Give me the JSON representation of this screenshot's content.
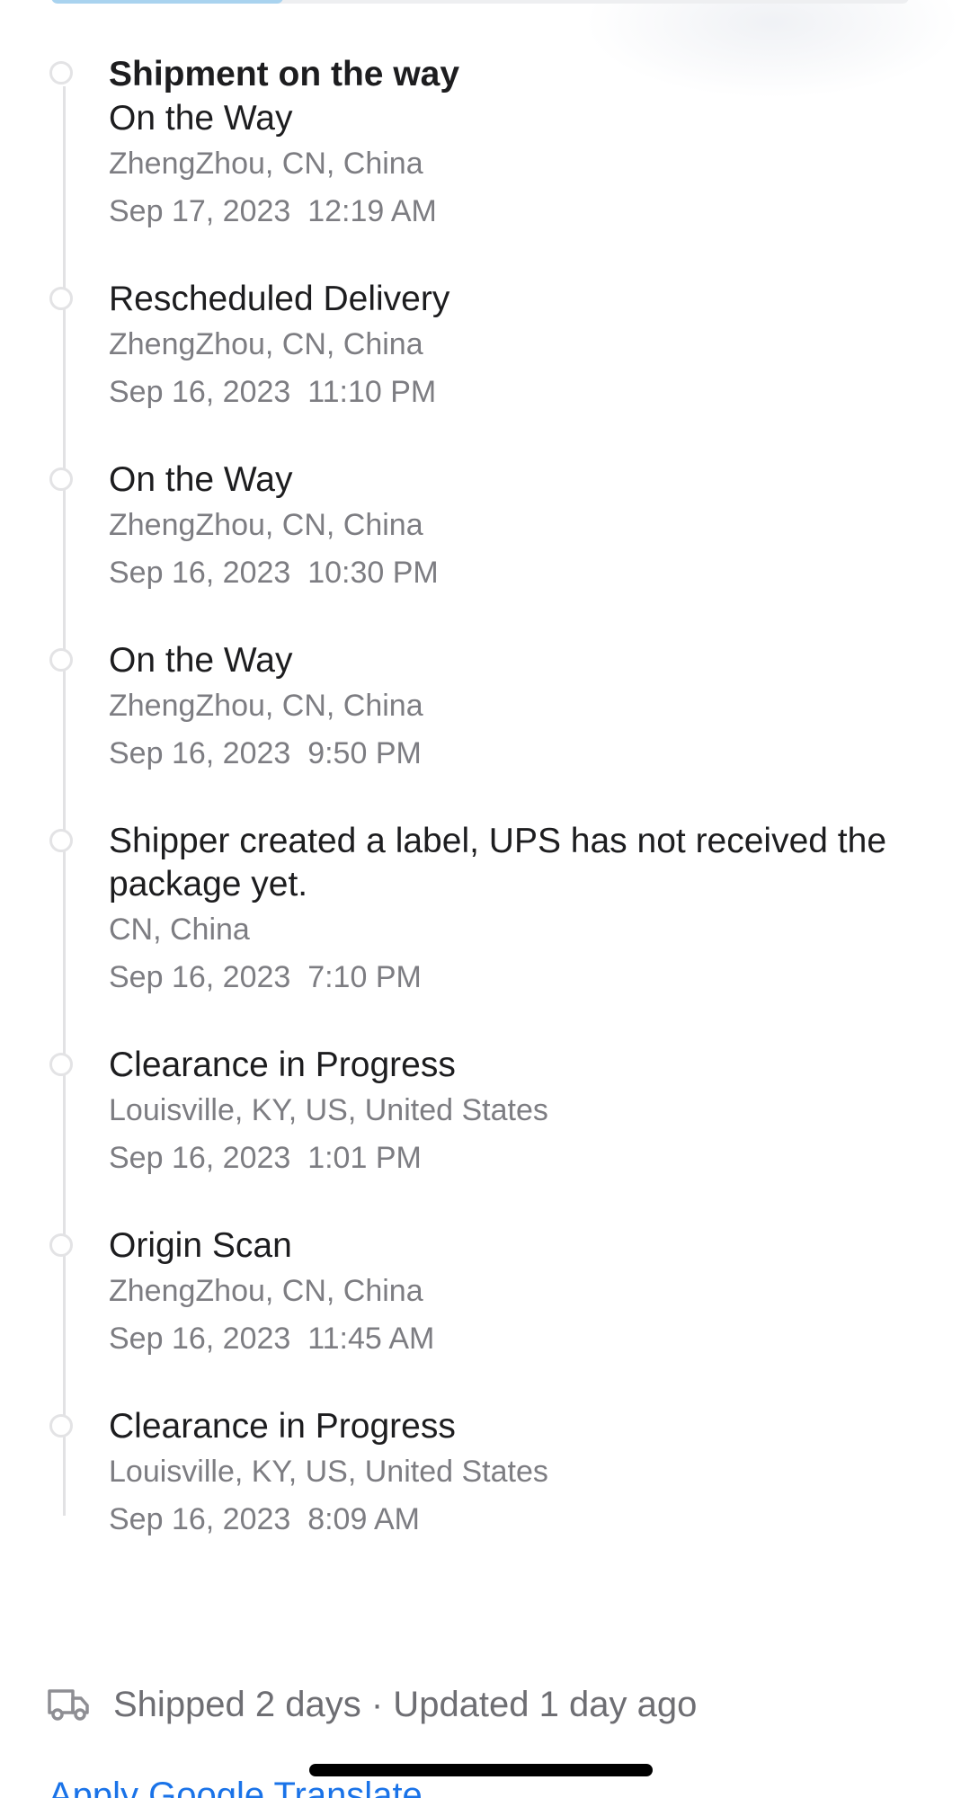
{
  "progress": {
    "fill_fraction": 0.27,
    "track_color": "#eeeff1",
    "fill_color": "#a9d3ef"
  },
  "events": [
    {
      "title": "Shipment on the way",
      "status": "On the Way",
      "location": "ZhengZhou, CN, China",
      "date": "Sep 17, 2023",
      "time": "12:19 AM"
    },
    {
      "status": "Rescheduled Delivery",
      "location": "ZhengZhou, CN, China",
      "date": "Sep 16, 2023",
      "time": "11:10 PM"
    },
    {
      "status": "On the Way",
      "location": "ZhengZhou, CN, China",
      "date": "Sep 16, 2023",
      "time": "10:30 PM"
    },
    {
      "status": "On the Way",
      "location": "ZhengZhou, CN, China",
      "date": "Sep 16, 2023",
      "time": "9:50 PM"
    },
    {
      "status": "Shipper created a label, UPS has not received the package yet.",
      "location": "CN, China",
      "date": "Sep 16, 2023",
      "time": "7:10 PM"
    },
    {
      "status": "Clearance in Progress",
      "location": "Louisville, KY, US, United States",
      "date": "Sep 16, 2023",
      "time": "1:01 PM"
    },
    {
      "status": "Origin Scan",
      "location": "ZhengZhou, CN, China",
      "date": "Sep 16, 2023",
      "time": "11:45 AM"
    },
    {
      "status": "Clearance in Progress",
      "location": "Louisville, KY, US, United States",
      "date": "Sep 16, 2023",
      "time": "8:09 AM"
    }
  ],
  "summary": {
    "icon": "truck-icon",
    "text": "Shipped 2 days · Updated 1 day ago"
  },
  "translate_link": "Apply Google Translate",
  "colors": {
    "primary_text": "#1d1d1f",
    "secondary_text": "#7d7d82",
    "link": "#1a73e8",
    "timeline": "#e2e2e4"
  }
}
